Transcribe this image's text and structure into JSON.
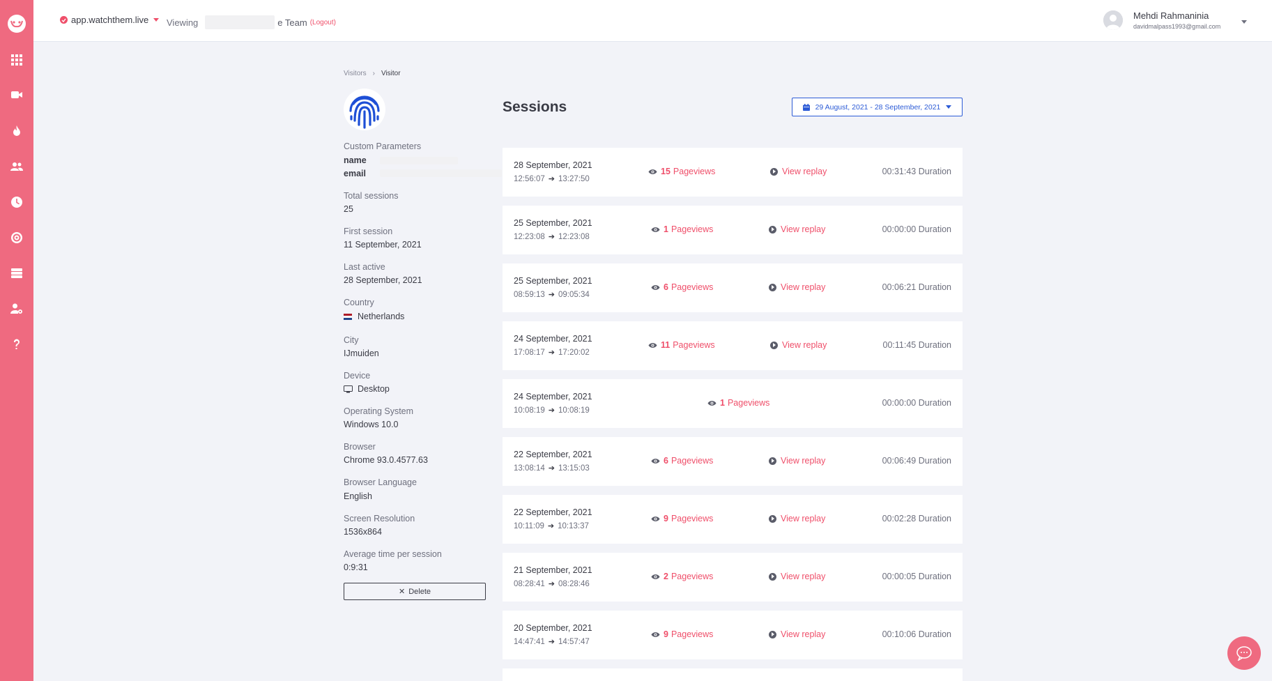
{
  "topbar": {
    "site": "app.watchthem.live",
    "viewing_label": "Viewing",
    "team_suffix": "e Team",
    "logout": "(Logout)",
    "user_name": "Mehdi Rahmaninia",
    "user_email": "davidmalpass1993@gmail.com"
  },
  "sidebar": {
    "icons": [
      "logo-icon",
      "dashboard-icon",
      "video-icon",
      "fire-icon",
      "users-icon",
      "clock-icon",
      "target-icon",
      "server-icon",
      "user-settings-icon",
      "help-icon"
    ]
  },
  "breadcrumb": {
    "parent": "Visitors",
    "separator": "›",
    "current": "Visitor"
  },
  "profile": {
    "custom_params_label": "Custom Parameters",
    "param_name_key": "name",
    "param_email_key": "email",
    "total_sessions_label": "Total sessions",
    "total_sessions": "25",
    "first_session_label": "First session",
    "first_session": "11 September, 2021",
    "last_active_label": "Last active",
    "last_active": "28 September, 2021",
    "country_label": "Country",
    "country": "Netherlands",
    "city_label": "City",
    "city": "IJmuiden",
    "device_label": "Device",
    "device": "Desktop",
    "os_label": "Operating System",
    "os": "Windows 10.0",
    "browser_label": "Browser",
    "browser": "Chrome 93.0.4577.63",
    "language_label": "Browser Language",
    "language": "English",
    "resolution_label": "Screen Resolution",
    "resolution": "1536x864",
    "avg_time_label": "Average time per session",
    "avg_time": "0:9:31",
    "delete_label": "Delete"
  },
  "sessions": {
    "title": "Sessions",
    "date_range": "29 August, 2021 - 28 September, 2021",
    "pageviews_label": "Pageviews",
    "view_replay_label": "View replay",
    "duration_label": "Duration",
    "items": [
      {
        "date": "28 September, 2021",
        "start": "12:56:07",
        "end": "13:27:50",
        "pageviews": "15",
        "duration": "00:31:43",
        "replay": true
      },
      {
        "date": "25 September, 2021",
        "start": "12:23:08",
        "end": "12:23:08",
        "pageviews": "1",
        "duration": "00:00:00",
        "replay": true
      },
      {
        "date": "25 September, 2021",
        "start": "08:59:13",
        "end": "09:05:34",
        "pageviews": "6",
        "duration": "00:06:21",
        "replay": true
      },
      {
        "date": "24 September, 2021",
        "start": "17:08:17",
        "end": "17:20:02",
        "pageviews": "11",
        "duration": "00:11:45",
        "replay": true
      },
      {
        "date": "24 September, 2021",
        "start": "10:08:19",
        "end": "10:08:19",
        "pageviews": "1",
        "duration": "00:00:00",
        "replay": false
      },
      {
        "date": "22 September, 2021",
        "start": "13:08:14",
        "end": "13:15:03",
        "pageviews": "6",
        "duration": "00:06:49",
        "replay": true
      },
      {
        "date": "22 September, 2021",
        "start": "10:11:09",
        "end": "10:13:37",
        "pageviews": "9",
        "duration": "00:02:28",
        "replay": true
      },
      {
        "date": "21 September, 2021",
        "start": "08:28:41",
        "end": "08:28:46",
        "pageviews": "2",
        "duration": "00:00:05",
        "replay": true
      },
      {
        "date": "20 September, 2021",
        "start": "14:47:41",
        "end": "14:57:47",
        "pageviews": "9",
        "duration": "00:10:06",
        "replay": true
      }
    ]
  },
  "colors": {
    "accent": "#ef4f6a",
    "sidebar": "#ef6a80",
    "link_blue": "#2c5bd6",
    "background": "#f2f3f8"
  }
}
